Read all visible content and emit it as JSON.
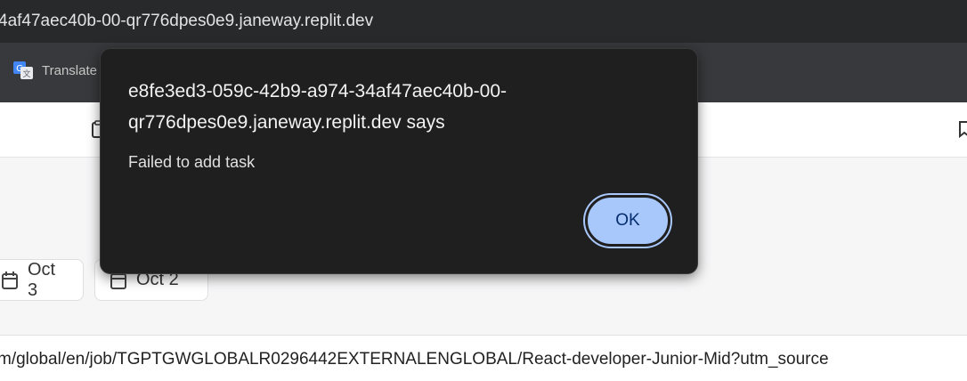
{
  "browser": {
    "address_text": "4af47aec40b-00-qr776dpes0e9.janeway.replit.dev",
    "bookmark_label": "Translate"
  },
  "chips": [
    {
      "label": "Oct 3"
    },
    {
      "label": "Oct 2"
    }
  ],
  "url_strip": {
    "text": "m/global/en/job/TGPTGWGLOBALR0296442EXTERNALENGLOBAL/React-developer-Junior-Mid?utm_source"
  },
  "dialog": {
    "title_line1": "e8fe3ed3-059c-42b9-a974-34af47aec40b-00-",
    "title_line2": "qr776dpes0e9.janeway.replit.dev says",
    "message": "Failed to add task",
    "ok_label": "OK"
  },
  "colors": {
    "dialog_bg": "#1f1f1f",
    "ok_bg": "#a8c7fa",
    "ok_text": "#062e6f",
    "chrome_bg": "#28292b"
  },
  "icons": [
    "translate-icon",
    "calendar-icon",
    "bookmark-icon"
  ]
}
